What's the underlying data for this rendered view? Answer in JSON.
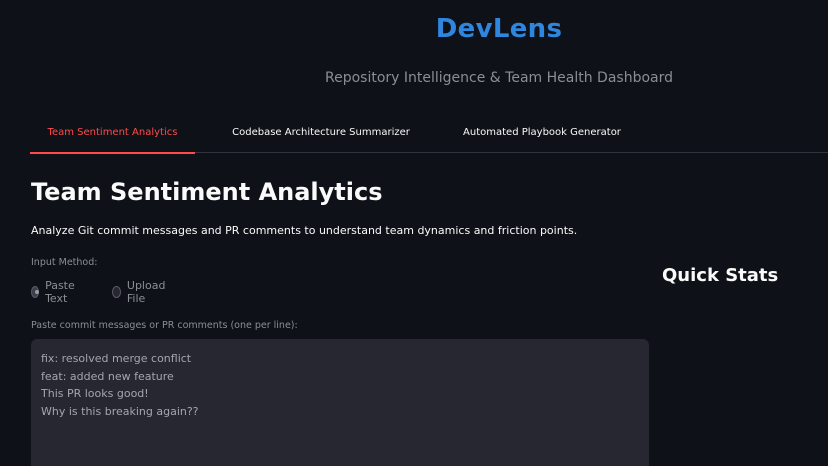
{
  "header": {
    "title": "DevLens",
    "subtitle": "Repository Intelligence & Team Health Dashboard",
    "title_color": "#2e86de"
  },
  "tabs": [
    {
      "label": "Team Sentiment Analytics",
      "active": true
    },
    {
      "label": "Codebase Architecture Summarizer",
      "active": false
    },
    {
      "label": "Automated Playbook Generator",
      "active": false
    }
  ],
  "colors": {
    "background": "#0e1117",
    "active_tab": "#ff4b4b",
    "input_bg": "#262730"
  },
  "main": {
    "title": "Team Sentiment Analytics",
    "description": "Analyze Git commit messages and PR comments to understand team dynamics and friction points.",
    "input_method": {
      "label": "Input Method:",
      "options": [
        {
          "label": "Paste Text",
          "selected": true
        },
        {
          "label": "Upload File",
          "selected": false
        }
      ]
    },
    "textarea": {
      "label": "Paste commit messages or PR comments (one per line):",
      "lines": [
        "fix: resolved merge conflict",
        "feat: added new feature",
        "This PR looks good!",
        "Why is this breaking again??"
      ]
    }
  },
  "sidebar": {
    "quick_stats_title": "Quick Stats"
  }
}
